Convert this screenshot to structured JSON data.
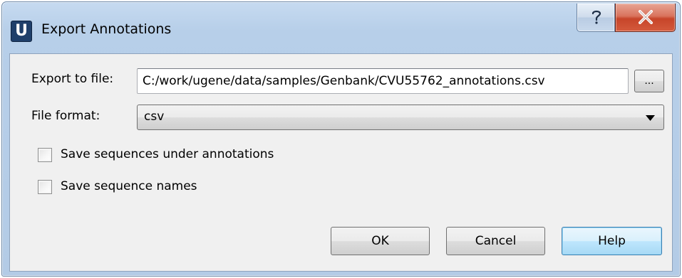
{
  "window": {
    "app_icon_letter": "U",
    "title": "Export Annotations",
    "help_caption_glyph": "?",
    "close_caption_glyph": "X"
  },
  "form": {
    "export_to_file_label": "Export to file:",
    "export_to_file_value": "C:/work/ugene/data/samples/Genbank/CVU55762_annotations.csv",
    "browse_label": "...",
    "file_format_label": "File format:",
    "file_format_value": "csv",
    "save_sequences_label": "Save sequences under annotations",
    "save_sequences_checked": false,
    "save_names_label": "Save sequence names",
    "save_names_checked": false
  },
  "buttons": {
    "ok_label": "OK",
    "cancel_label": "Cancel",
    "help_label": "Help"
  },
  "colors": {
    "title_bar": "#b9d1ea",
    "close_button": "#c7452a",
    "default_button_border": "#3c7fb1",
    "client_background": "#f0f0f0"
  }
}
